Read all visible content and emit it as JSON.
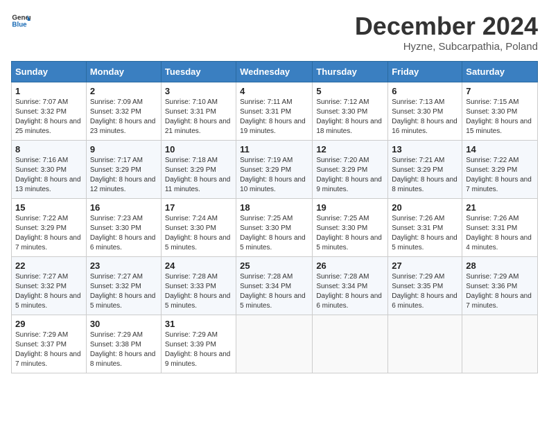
{
  "header": {
    "logo_general": "General",
    "logo_blue": "Blue",
    "month_title": "December 2024",
    "subtitle": "Hyzne, Subcarpathia, Poland"
  },
  "days_of_week": [
    "Sunday",
    "Monday",
    "Tuesday",
    "Wednesday",
    "Thursday",
    "Friday",
    "Saturday"
  ],
  "weeks": [
    [
      {
        "day": "1",
        "sunrise": "7:07 AM",
        "sunset": "3:32 PM",
        "daylight": "8 hours and 25 minutes."
      },
      {
        "day": "2",
        "sunrise": "7:09 AM",
        "sunset": "3:32 PM",
        "daylight": "8 hours and 23 minutes."
      },
      {
        "day": "3",
        "sunrise": "7:10 AM",
        "sunset": "3:31 PM",
        "daylight": "8 hours and 21 minutes."
      },
      {
        "day": "4",
        "sunrise": "7:11 AM",
        "sunset": "3:31 PM",
        "daylight": "8 hours and 19 minutes."
      },
      {
        "day": "5",
        "sunrise": "7:12 AM",
        "sunset": "3:30 PM",
        "daylight": "8 hours and 18 minutes."
      },
      {
        "day": "6",
        "sunrise": "7:13 AM",
        "sunset": "3:30 PM",
        "daylight": "8 hours and 16 minutes."
      },
      {
        "day": "7",
        "sunrise": "7:15 AM",
        "sunset": "3:30 PM",
        "daylight": "8 hours and 15 minutes."
      }
    ],
    [
      {
        "day": "8",
        "sunrise": "7:16 AM",
        "sunset": "3:30 PM",
        "daylight": "8 hours and 13 minutes."
      },
      {
        "day": "9",
        "sunrise": "7:17 AM",
        "sunset": "3:29 PM",
        "daylight": "8 hours and 12 minutes."
      },
      {
        "day": "10",
        "sunrise": "7:18 AM",
        "sunset": "3:29 PM",
        "daylight": "8 hours and 11 minutes."
      },
      {
        "day": "11",
        "sunrise": "7:19 AM",
        "sunset": "3:29 PM",
        "daylight": "8 hours and 10 minutes."
      },
      {
        "day": "12",
        "sunrise": "7:20 AM",
        "sunset": "3:29 PM",
        "daylight": "8 hours and 9 minutes."
      },
      {
        "day": "13",
        "sunrise": "7:21 AM",
        "sunset": "3:29 PM",
        "daylight": "8 hours and 8 minutes."
      },
      {
        "day": "14",
        "sunrise": "7:22 AM",
        "sunset": "3:29 PM",
        "daylight": "8 hours and 7 minutes."
      }
    ],
    [
      {
        "day": "15",
        "sunrise": "7:22 AM",
        "sunset": "3:29 PM",
        "daylight": "8 hours and 7 minutes."
      },
      {
        "day": "16",
        "sunrise": "7:23 AM",
        "sunset": "3:30 PM",
        "daylight": "8 hours and 6 minutes."
      },
      {
        "day": "17",
        "sunrise": "7:24 AM",
        "sunset": "3:30 PM",
        "daylight": "8 hours and 5 minutes."
      },
      {
        "day": "18",
        "sunrise": "7:25 AM",
        "sunset": "3:30 PM",
        "daylight": "8 hours and 5 minutes."
      },
      {
        "day": "19",
        "sunrise": "7:25 AM",
        "sunset": "3:30 PM",
        "daylight": "8 hours and 5 minutes."
      },
      {
        "day": "20",
        "sunrise": "7:26 AM",
        "sunset": "3:31 PM",
        "daylight": "8 hours and 5 minutes."
      },
      {
        "day": "21",
        "sunrise": "7:26 AM",
        "sunset": "3:31 PM",
        "daylight": "8 hours and 4 minutes."
      }
    ],
    [
      {
        "day": "22",
        "sunrise": "7:27 AM",
        "sunset": "3:32 PM",
        "daylight": "8 hours and 5 minutes."
      },
      {
        "day": "23",
        "sunrise": "7:27 AM",
        "sunset": "3:32 PM",
        "daylight": "8 hours and 5 minutes."
      },
      {
        "day": "24",
        "sunrise": "7:28 AM",
        "sunset": "3:33 PM",
        "daylight": "8 hours and 5 minutes."
      },
      {
        "day": "25",
        "sunrise": "7:28 AM",
        "sunset": "3:34 PM",
        "daylight": "8 hours and 5 minutes."
      },
      {
        "day": "26",
        "sunrise": "7:28 AM",
        "sunset": "3:34 PM",
        "daylight": "8 hours and 6 minutes."
      },
      {
        "day": "27",
        "sunrise": "7:29 AM",
        "sunset": "3:35 PM",
        "daylight": "8 hours and 6 minutes."
      },
      {
        "day": "28",
        "sunrise": "7:29 AM",
        "sunset": "3:36 PM",
        "daylight": "8 hours and 7 minutes."
      }
    ],
    [
      {
        "day": "29",
        "sunrise": "7:29 AM",
        "sunset": "3:37 PM",
        "daylight": "8 hours and 7 minutes."
      },
      {
        "day": "30",
        "sunrise": "7:29 AM",
        "sunset": "3:38 PM",
        "daylight": "8 hours and 8 minutes."
      },
      {
        "day": "31",
        "sunrise": "7:29 AM",
        "sunset": "3:39 PM",
        "daylight": "8 hours and 9 minutes."
      },
      null,
      null,
      null,
      null
    ]
  ]
}
